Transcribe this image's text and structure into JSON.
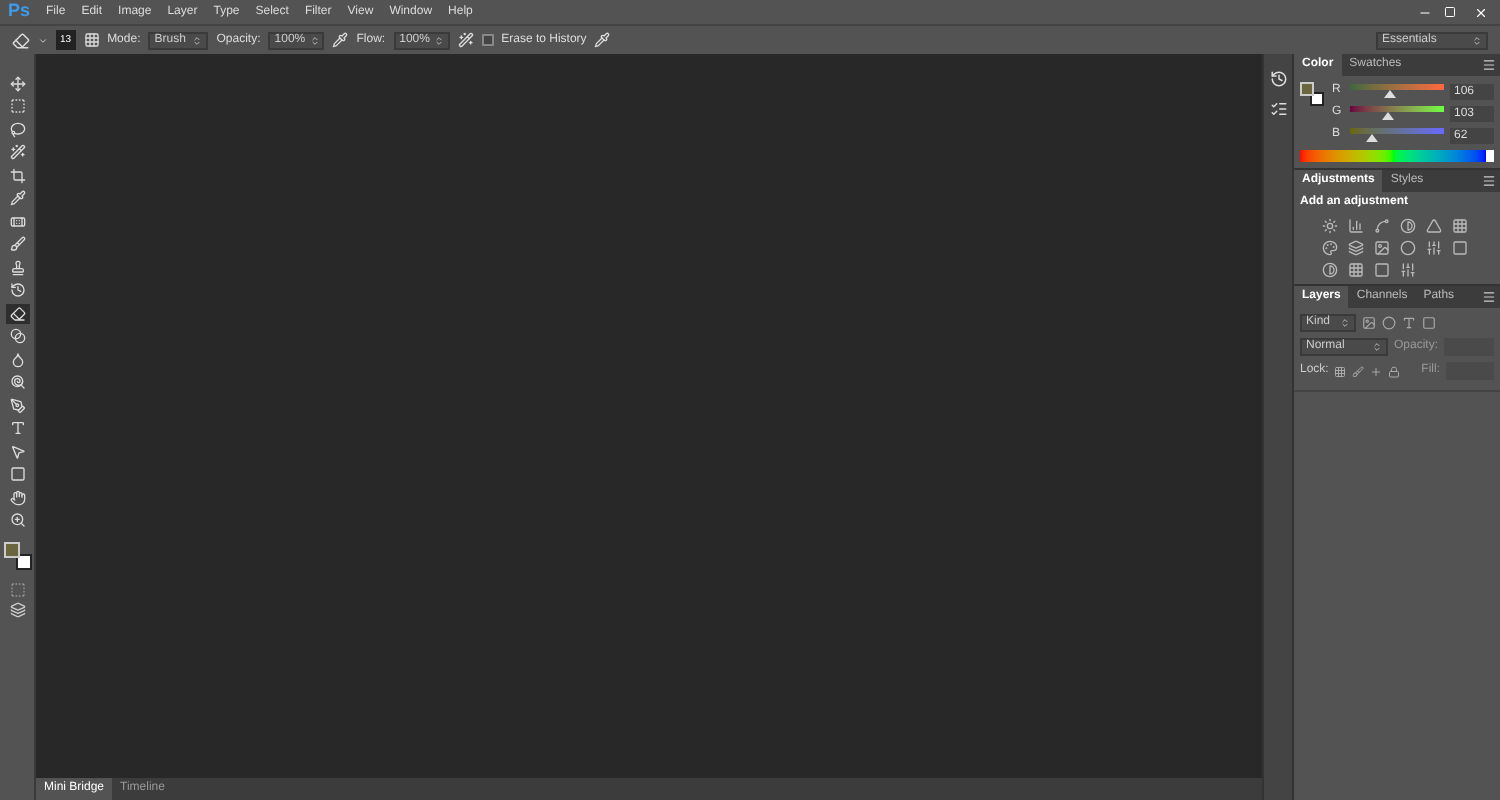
{
  "app": {
    "logo": "Ps"
  },
  "menu": [
    "File",
    "Edit",
    "Image",
    "Layer",
    "Type",
    "Select",
    "Filter",
    "View",
    "Window",
    "Help"
  ],
  "options": {
    "brush_size": "13",
    "mode_label": "Mode:",
    "mode": "Brush",
    "opacity_label": "Opacity:",
    "opacity": "100%",
    "flow_label": "Flow:",
    "flow": "100%",
    "erase_to_history": {
      "label": "Erase to History",
      "checked": false
    },
    "workspace": "Essentials"
  },
  "tools": [
    {
      "kind": "move",
      "selected": false
    },
    {
      "kind": "marquee",
      "selected": false
    },
    {
      "kind": "lasso",
      "selected": false
    },
    {
      "kind": "quick-select",
      "selected": false
    },
    {
      "kind": "crop",
      "selected": false
    },
    {
      "kind": "eyedropper",
      "selected": false
    },
    {
      "kind": "healing",
      "selected": false
    },
    {
      "kind": "brush",
      "selected": false
    },
    {
      "kind": "stamp",
      "selected": false
    },
    {
      "kind": "history-brush",
      "selected": false
    },
    {
      "kind": "eraser",
      "selected": true
    },
    {
      "kind": "gradient",
      "selected": false
    },
    {
      "kind": "blur",
      "selected": false
    },
    {
      "kind": "dodge",
      "selected": false
    },
    {
      "kind": "pen",
      "selected": false
    },
    {
      "kind": "type",
      "selected": false
    },
    {
      "kind": "path-select",
      "selected": false
    },
    {
      "kind": "shape",
      "selected": false
    },
    {
      "kind": "hand",
      "selected": false
    },
    {
      "kind": "zoom",
      "selected": false
    }
  ],
  "colors": [
    {
      "kind": "foreground",
      "color": "#6a673e"
    },
    {
      "kind": "background",
      "color": "#ffffff"
    }
  ],
  "color_panel": {
    "tabs": [
      {
        "label": "Color",
        "selected": true
      },
      {
        "label": "Swatches",
        "selected": false
      }
    ],
    "swatches": [
      {
        "kind": "foreground",
        "color": "#6a673e"
      },
      {
        "kind": "background",
        "color": "#ffffff"
      }
    ],
    "channels": [
      {
        "name": "R",
        "value": "106",
        "level": 0.416
      },
      {
        "name": "G",
        "value": "103",
        "level": 0.404
      },
      {
        "name": "B",
        "value": "62",
        "level": 0.243
      }
    ]
  },
  "adjustments_panel": {
    "tabs": [
      {
        "label": "Adjustments",
        "selected": true
      },
      {
        "label": "Styles",
        "selected": false
      }
    ],
    "title": "Add an adjustment"
  },
  "layers_panel": {
    "tabs": [
      {
        "label": "Layers",
        "selected": true
      },
      {
        "label": "Channels",
        "selected": false
      },
      {
        "label": "Paths",
        "selected": false
      }
    ],
    "filter": "Kind",
    "blend_mode": "Normal",
    "opacity_label": "Opacity:",
    "lock_label": "Lock:",
    "fill_label": "Fill:"
  },
  "bottom_tabs": [
    {
      "label": "Mini Bridge",
      "selected": true
    },
    {
      "label": "Timeline",
      "selected": false
    }
  ]
}
